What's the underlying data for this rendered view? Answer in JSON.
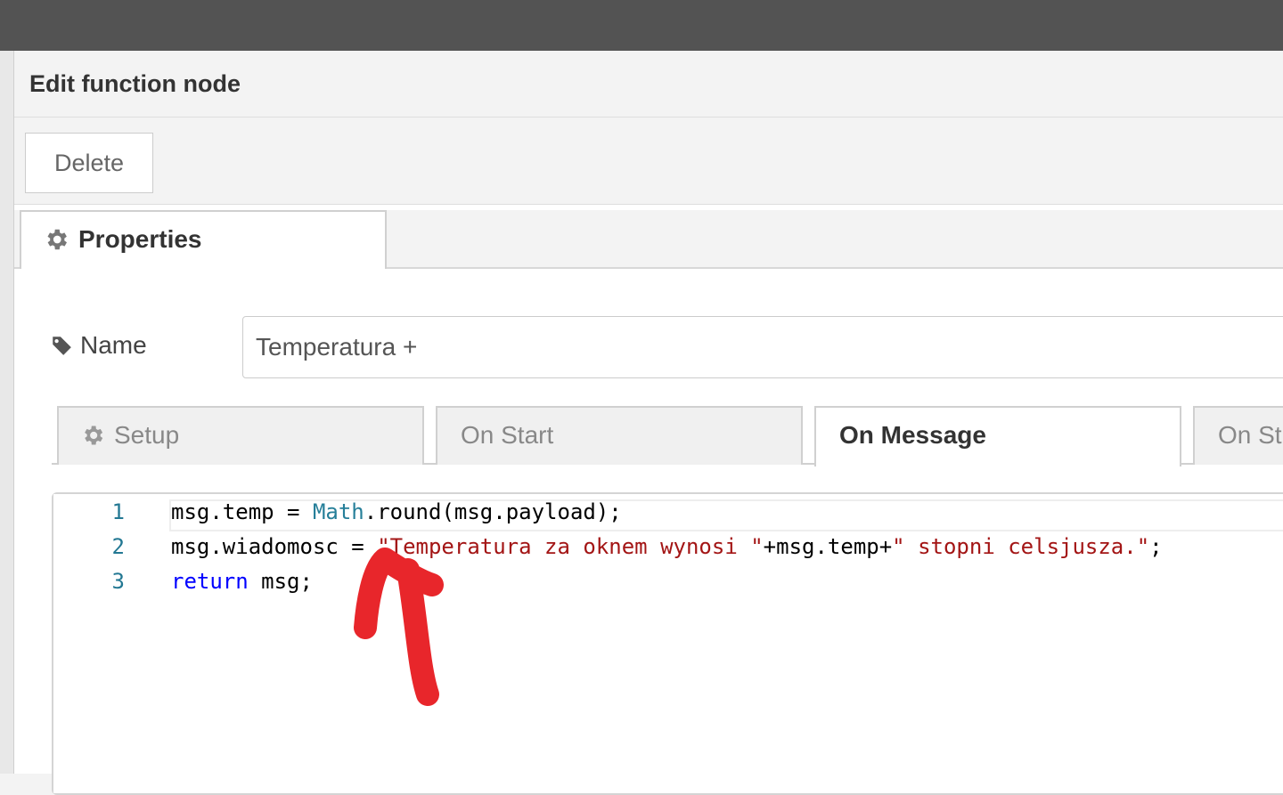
{
  "tray": {
    "title": "Edit function node",
    "delete_label": "Delete"
  },
  "properties_tab": {
    "label": "Properties",
    "icon": "gear-icon"
  },
  "name_field": {
    "label": "Name",
    "icon": "tag-icon",
    "value": "Temperatura +"
  },
  "code_tabs": [
    {
      "label": "Setup",
      "icon": "gear-icon",
      "active": false
    },
    {
      "label": "On Start",
      "active": false
    },
    {
      "label": "On Message",
      "active": true
    },
    {
      "label": "On St",
      "active": false
    }
  ],
  "editor": {
    "lines": [
      {
        "no": "1",
        "text": "msg.temp = Math.round(msg.payload);"
      },
      {
        "no": "2",
        "text": "msg.wiadomosc = \"Temperatura za oknem wynosi \"+msg.temp+\" stopni celsjusza.\";"
      },
      {
        "no": "3",
        "text": "return msg;"
      }
    ]
  },
  "colors": {
    "topbar": "#535353",
    "keyword": "#0000ff",
    "type": "#267f99",
    "string": "#a31515",
    "line_number": "#237893",
    "annotation": "#e8262b"
  }
}
